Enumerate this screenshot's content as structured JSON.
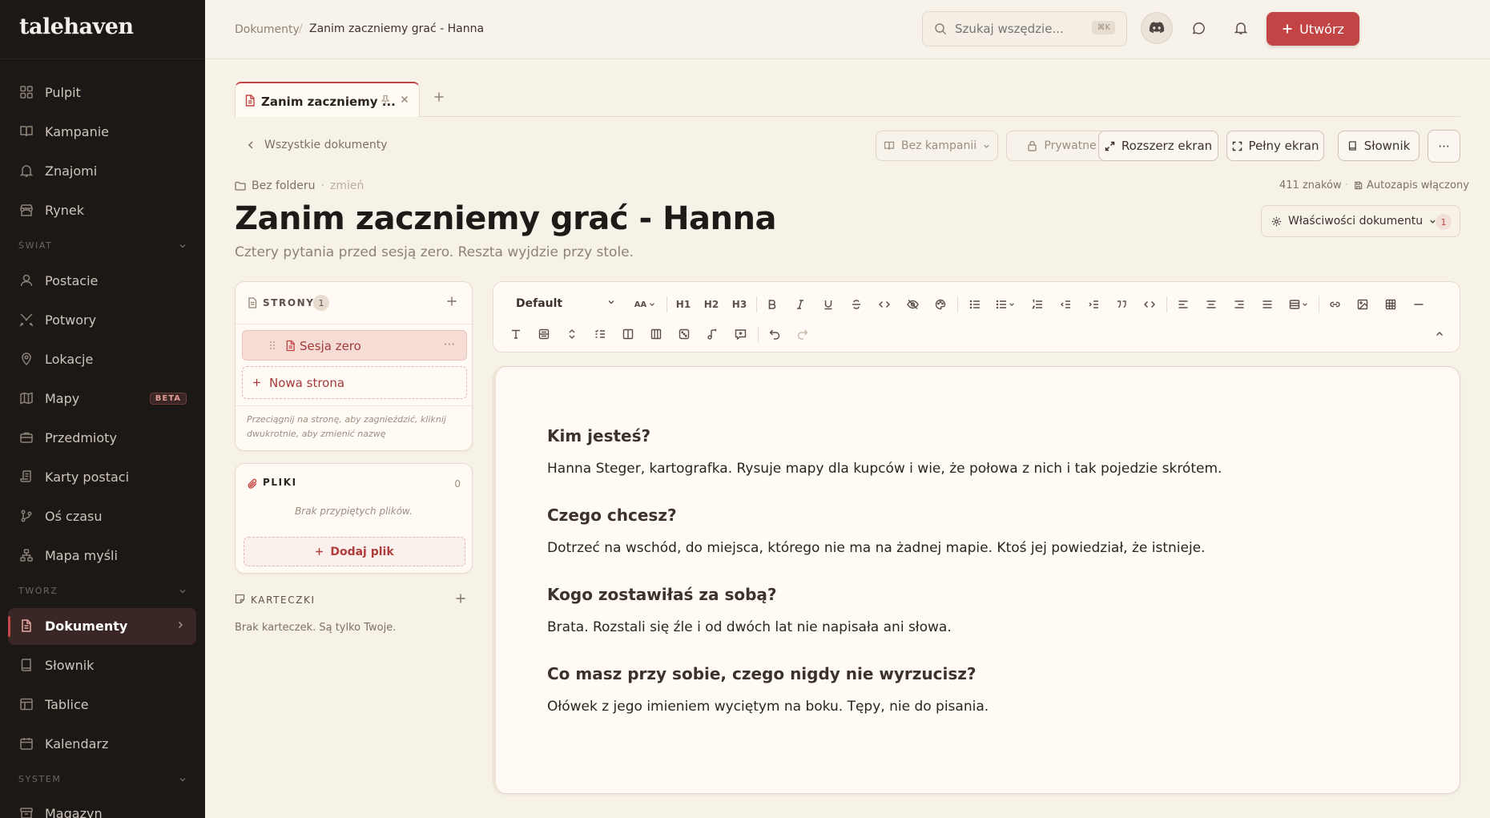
{
  "app": {
    "logo": "talehaven"
  },
  "sidebar": {
    "items": [
      {
        "label": "Pulpit",
        "icon": "grid-icon"
      },
      {
        "label": "Kampanie",
        "icon": "book-open-icon"
      },
      {
        "label": "Znajomi",
        "icon": "bell-icon"
      },
      {
        "label": "Rynek",
        "icon": "store-icon"
      }
    ],
    "sections": {
      "world": "ŚWIAT",
      "create": "TWÓRZ",
      "system": "SYSTEM"
    },
    "world_items": [
      {
        "label": "Postacie"
      },
      {
        "label": "Potwory"
      },
      {
        "label": "Lokacje"
      },
      {
        "label": "Mapy",
        "badge": "BETA"
      },
      {
        "label": "Przedmioty"
      },
      {
        "label": "Karty postaci"
      },
      {
        "label": "Oś czasu"
      },
      {
        "label": "Mapa myśli"
      }
    ],
    "create_items": [
      {
        "label": "Dokumenty"
      },
      {
        "label": "Słownik"
      },
      {
        "label": "Tablice"
      },
      {
        "label": "Kalendarz"
      }
    ],
    "system_items": [
      {
        "label": "Magazyn"
      }
    ]
  },
  "topbar": {
    "breadcrumb": [
      "Dokumenty",
      "Zanim zaczniemy grać - Hanna"
    ],
    "breadcrumb_sep": "/",
    "search_placeholder": "Szukaj wszędzie...",
    "search_kbd": "⌘K",
    "create_label": "Utwórz"
  },
  "tabs": [
    {
      "label": "Zanim zaczniemy ..."
    }
  ],
  "doc_toolbar": {
    "back": "Wszystkie dokumenty",
    "campaign": "Bez kampanii",
    "privacy": "Prywatne",
    "expand": "Rozszerz ekran",
    "fullscreen": "Pełny ekran",
    "dictionary": "Słownik",
    "more": "···"
  },
  "meta": {
    "folder": "Bez folderu",
    "folder_sep": "·",
    "change": "zmień",
    "chars": "411 znaków",
    "chars_sep": "·",
    "autosave": "Autozapis włączony",
    "properties": "Właściwości dokumentu",
    "properties_count": "1"
  },
  "document": {
    "title": "Zanim zaczniemy grać - Hanna",
    "subtitle": "Cztery pytania przed sesją zero. Reszta wyjdzie przy stole."
  },
  "pages_panel": {
    "title": "STRONY",
    "count": "1",
    "items": [
      {
        "label": "Sesja zero"
      }
    ],
    "new_page": "Nowa strona",
    "hint": "Przeciągnij na stronę, aby zagnieździć, kliknij dwukrotnie, aby zmienić nazwę"
  },
  "files_panel": {
    "title": "PLIKI",
    "count": "0",
    "empty": "Brak przypiętych plików.",
    "add": "Dodaj plik"
  },
  "cards_panel": {
    "title": "KARTECZKI",
    "empty": "Brak karteczek. Są tylko Twoje."
  },
  "editor_toolbar": {
    "style": "Default",
    "font_size": "AA",
    "h1": "H1",
    "h2": "H2",
    "h3": "H3"
  },
  "content": [
    {
      "q": "Kim jesteś?",
      "a": "Hanna Steger, kartografka. Rysuje mapy dla kupców i wie, że połowa z nich i tak pojedzie skrótem."
    },
    {
      "q": "Czego chcesz?",
      "a": "Dotrzeć na wschód, do miejsca, którego nie ma na żadnej mapie. Ktoś jej powiedział, że istnieje."
    },
    {
      "q": "Kogo zostawiłaś za sobą?",
      "a": "Brata. Rozstali się źle i od dwóch lat nie napisała ani słowa."
    },
    {
      "q": "Co masz przy sobie, czego nigdy nie wyrzucisz?",
      "a": "Ołówek z jego imieniem wyciętym na boku. Tępy, nie do pisania."
    }
  ],
  "colors": {
    "accent": "#c24444",
    "sidebar": "#1c1816",
    "background": "#f7f2e8"
  }
}
